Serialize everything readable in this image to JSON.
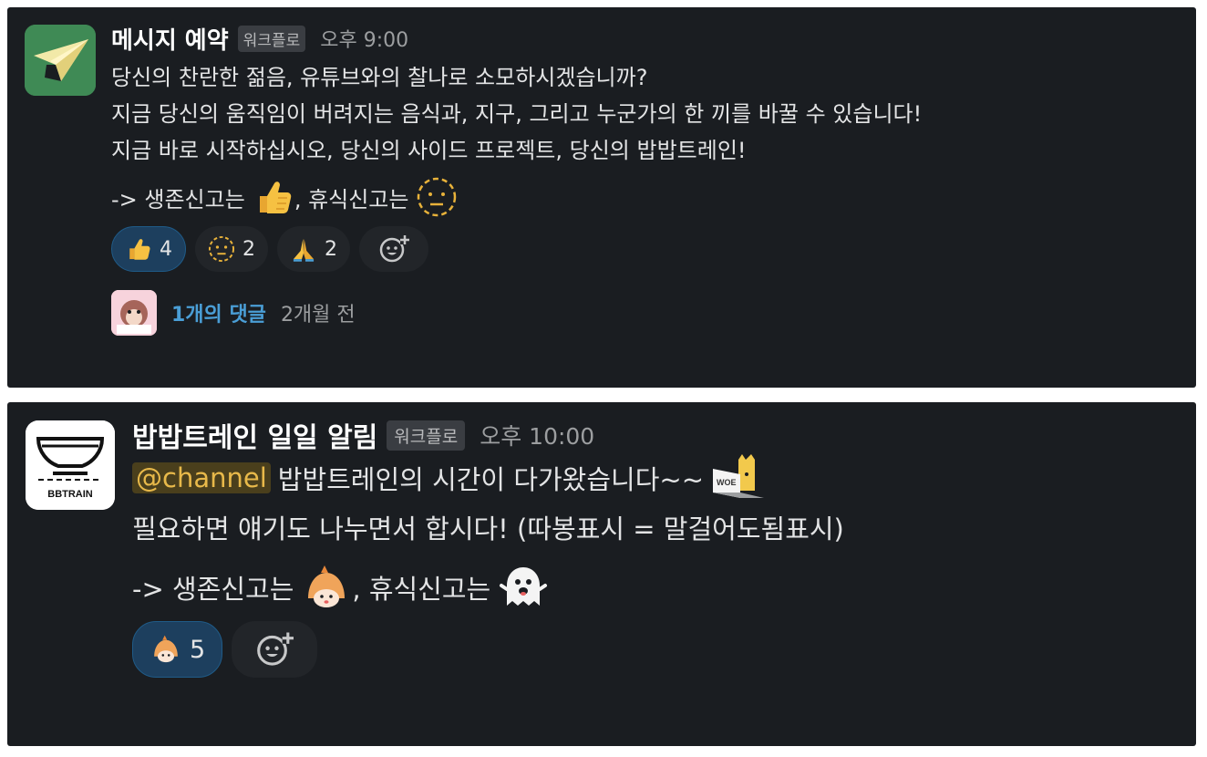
{
  "messages": [
    {
      "sender": "메시지 예약",
      "app_badge": "워크플로",
      "time": "오후 9:00",
      "lines": [
        "당신의 찬란한 젊음, 유튜브와의 찰나로 소모하시겠습니까?",
        "지금 당신의 움직임이 버려지는 음식과, 지구, 그리고 누군가의 한 끼를 바꿀 수 있습니다!",
        "지금 바로 시작하십시오, 당신의 사이드 프로젝트, 당신의 밥밥트레인!"
      ],
      "signal_line": {
        "prefix": "-> 생존신고는",
        "middle": ", 휴식신고는",
        "emoji_1": "thumbsup-icon",
        "emoji_2": "dotted-line-face-icon"
      },
      "reactions": [
        {
          "emoji": "thumbsup-icon",
          "count": "4",
          "active": true
        },
        {
          "emoji": "dotted-line-face-icon",
          "count": "2",
          "active": false
        },
        {
          "emoji": "folded-hands-icon",
          "count": "2",
          "active": false
        }
      ],
      "add_reaction_icon": "add-reaction-icon",
      "thread": {
        "link": "1개의 댓글",
        "time": "2개월 전"
      }
    },
    {
      "sender": "밥밥트레인 일일 알림",
      "app_badge": "워크플로",
      "time": "오후 10:00",
      "avatar_text": "BBTRAIN",
      "mention": "@channel",
      "line_1": "밥밥트레인의 시간이 다가왔습니다~~",
      "line_2": "필요하면 얘기도 나누면서 합시다! (따봉표시 = 말걸어도됨표시)",
      "laptop_text": "WOE",
      "signal_line": {
        "prefix": "-> 생존신고는",
        "middle": ", 휴식신고는",
        "emoji_1": "orange-creature-icon",
        "emoji_2": "ghost-icon"
      },
      "reactions": [
        {
          "emoji": "orange-creature-icon",
          "count": "5",
          "active": true
        }
      ],
      "add_reaction_icon": "add-reaction-icon"
    }
  ],
  "colors": {
    "card_bg": "#1a1d21",
    "link": "#4a9ed6",
    "mention_text": "#e8b94a",
    "active_reaction_bg": "#1d3f5e"
  }
}
